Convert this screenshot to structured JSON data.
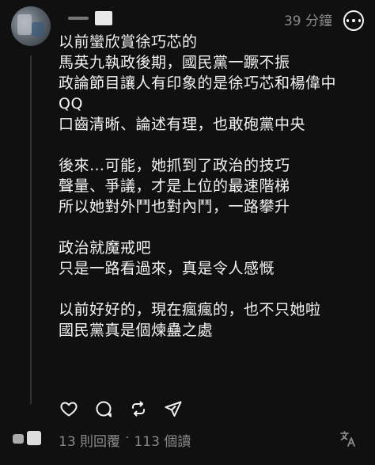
{
  "post": {
    "timestamp": "39 分鐘",
    "lines": [
      "以前蠻欣賞徐巧芯的",
      "馬英九執政後期，國民黨一蹶不振",
      "政論節目讓人有印象的是徐巧芯和楊偉中",
      "QQ",
      "口齒清晰、論述有理，也敢砲黨中央",
      "",
      "後來…可能，她抓到了政治的技巧",
      "聲量、爭議，才是上位的最速階梯",
      "所以她對外鬥也對內鬥，一路攀升",
      "",
      "政治就魔戒吧",
      "只是一路看過來，真是令人感慨",
      "",
      "以前好好的，現在瘋瘋的，也不只她啦",
      "國民黨真是個煉蠱之處"
    ]
  },
  "actions": {
    "icons": [
      "heart-icon",
      "comment-icon",
      "repost-icon",
      "share-icon",
      "more-icon",
      "translate-icon"
    ]
  },
  "footer": {
    "replies": "13 則回覆",
    "separator": "·",
    "views": "113 個讀"
  },
  "colors": {
    "background": "#101010",
    "text": "#f3f3f3",
    "muted": "#8a8a8a"
  }
}
